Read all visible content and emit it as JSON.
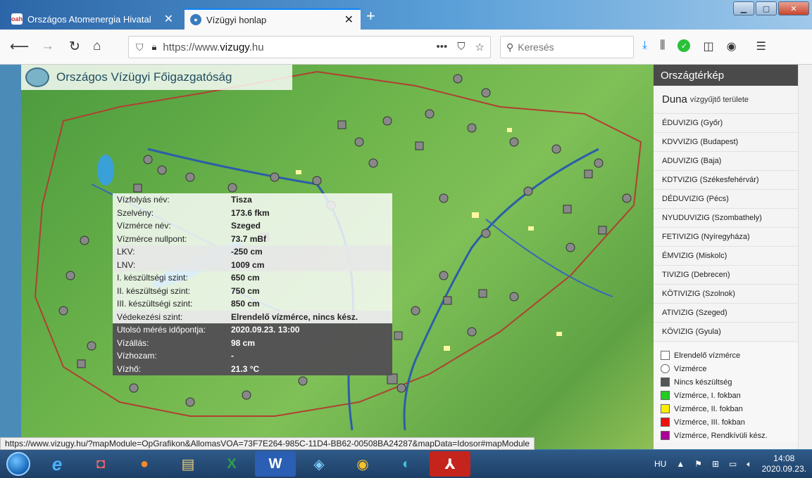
{
  "browser": {
    "tabs": [
      {
        "title": "Országos Atomenergia Hivatal",
        "active": false
      },
      {
        "title": "Vízügyi honlap",
        "active": true
      }
    ],
    "url_prefix": "https://www.",
    "url_domain": "vizugy",
    "url_suffix": ".hu",
    "search_placeholder": "Keresés"
  },
  "site": {
    "brand": "Országos Vízügyi Főigazgatóság"
  },
  "station": {
    "rows": [
      {
        "label": "Vízfolyás név:",
        "value": "Tisza"
      },
      {
        "label": "Szelvény:",
        "value": "173.6 fkm"
      },
      {
        "label": "Vízmérce név:",
        "value": "Szeged"
      },
      {
        "label": "Vízmérce nullpont:",
        "value": "73.7 mBf"
      },
      {
        "label": "LKV:",
        "value": "-250 cm"
      },
      {
        "label": "LNV:",
        "value": "1009 cm"
      },
      {
        "label": "I. készültségi szint:",
        "value": "650 cm"
      },
      {
        "label": "II. készültségi szint:",
        "value": "750 cm"
      },
      {
        "label": "III. készültségi szint:",
        "value": "850 cm"
      },
      {
        "label": "Védekezési szint:",
        "value": "Elrendelő vízmérce, nincs kész."
      },
      {
        "label": "Utolsó mérés időpontja:",
        "value": "2020.09.23. 13:00"
      },
      {
        "label": "Vízállás:",
        "value": "98 cm"
      },
      {
        "label": "Vízhozam:",
        "value": "-"
      },
      {
        "label": "Vízhő:",
        "value": "21.3 °C"
      }
    ]
  },
  "panel": {
    "title": "Országtérkép",
    "basin_name": "Duna",
    "basin_suffix": "vízgyűjtő területe",
    "items": [
      "ÉDUVIZIG (Győr)",
      "KDVVIZIG (Budapest)",
      "ADUVIZIG (Baja)",
      "KDTVIZIG (Székesfehérvár)",
      "DÉDUVIZIG (Pécs)",
      "NYUDUVIZIG (Szombathely)",
      "FETIVIZIG (Nyíregyháza)",
      "ÉMVIZIG (Miskolc)",
      "TIVIZIG (Debrecen)",
      "KÖTIVIZIG (Szolnok)",
      "ATIVIZIG (Szeged)",
      "KÖVIZIG (Gyula)"
    ]
  },
  "legend": [
    {
      "label": "Elrendelő vízmérce",
      "color": "#ffffff",
      "shape": "square"
    },
    {
      "label": "Vízmérce",
      "color": "#ffffff",
      "shape": "circle"
    },
    {
      "label": "Nincs készültség",
      "color": "#555555",
      "shape": "square"
    },
    {
      "label": "Vízmérce, I. fokban",
      "color": "#22cc22",
      "shape": "square"
    },
    {
      "label": "Vízmérce, II. fokban",
      "color": "#ffee00",
      "shape": "square"
    },
    {
      "label": "Vízmérce, III. fokban",
      "color": "#ee1111",
      "shape": "square"
    },
    {
      "label": "Vízmérce, Rendkívüli kész.",
      "color": "#aa0099",
      "shape": "square"
    }
  ],
  "status_url": "https://www.vizugy.hu/?mapModule=OpGrafikon&AllomasVOA=73F7E264-985C-11D4-BB62-00508BA24287&mapData=Idosor#mapModule",
  "taskbar": {
    "lang": "HU",
    "time": "14:08",
    "date": "2020.09.23."
  }
}
